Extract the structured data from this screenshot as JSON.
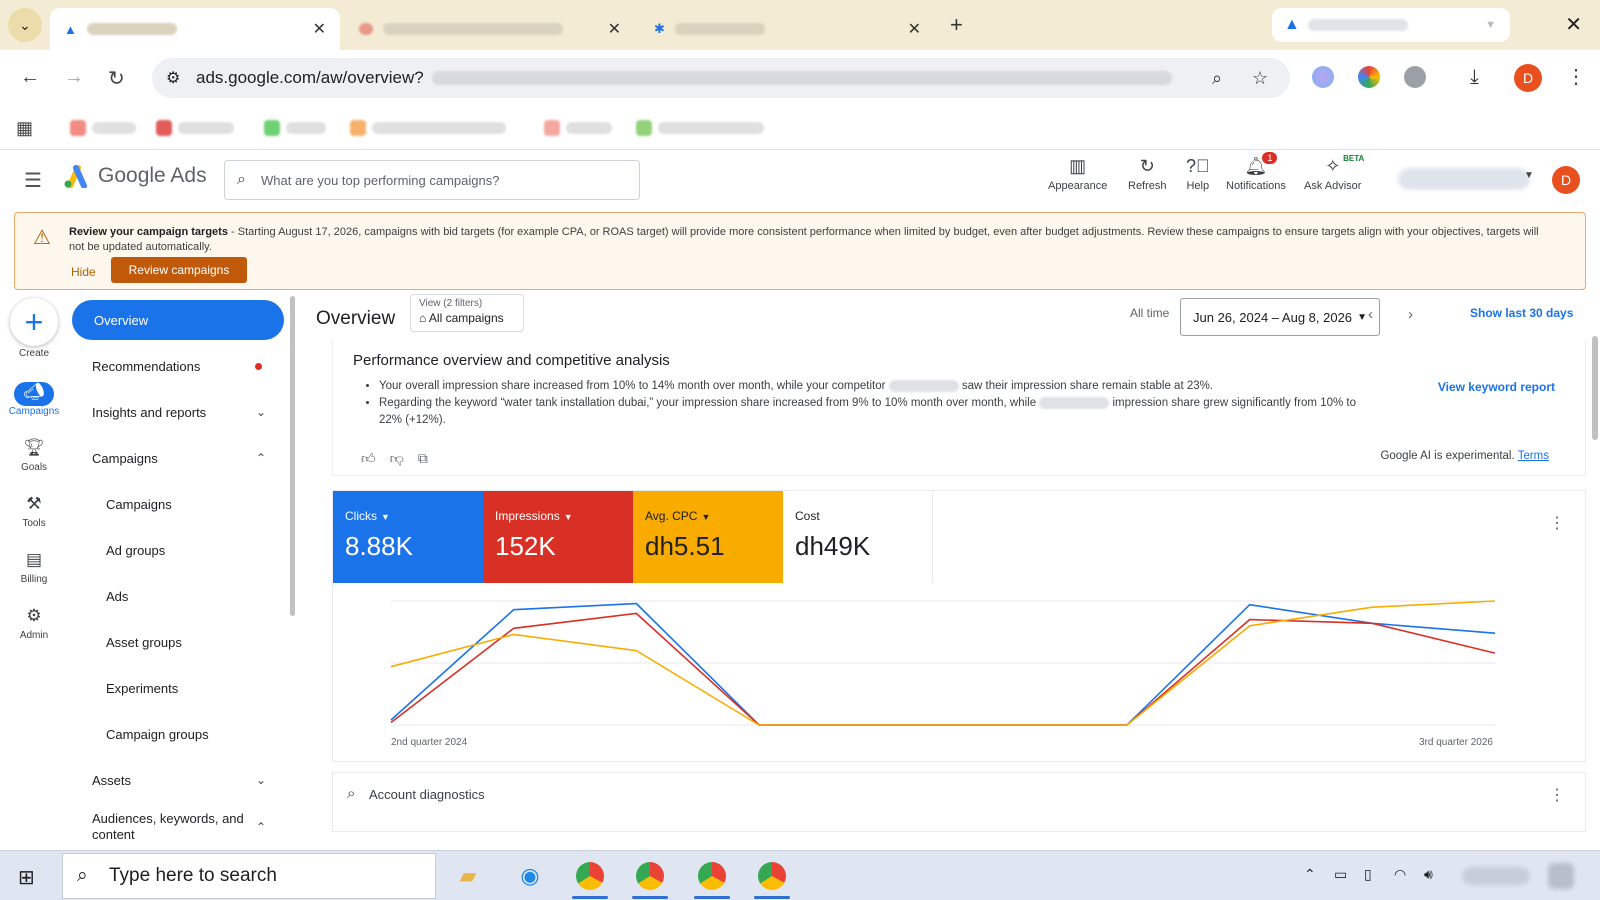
{
  "browser": {
    "url": "ads.google.com/aw/overview?"
  },
  "header": {
    "logo_text": "Google Ads",
    "search_placeholder": "What are you top performing campaigns?",
    "buttons": [
      {
        "label": "Appearance",
        "icon": "appearance-icon"
      },
      {
        "label": "Refresh",
        "icon": "refresh-icon"
      },
      {
        "label": "Help",
        "icon": "help-icon"
      },
      {
        "label": "Notifications",
        "icon": "bell-icon",
        "badge": "1"
      },
      {
        "label": "Ask Advisor",
        "icon": "advisor-icon",
        "tag": "BETA"
      }
    ],
    "avatar": "D"
  },
  "banner": {
    "title": "Review your campaign targets",
    "text": " - Starting August 17, 2026, campaigns with bid targets (for example CPA, or ROAS target) will provide more consistent performance when limited by budget, even after budget adjustments. Review these campaigns to ensure targets align with your objectives, targets will not be updated automatically.",
    "hide_label": "Hide",
    "action_label": "Review campaigns"
  },
  "rail": {
    "create": "Create",
    "items": [
      {
        "label": "Campaigns",
        "icon": "campaigns-icon",
        "active": true
      },
      {
        "label": "Goals",
        "icon": "trophy-icon"
      },
      {
        "label": "Tools",
        "icon": "tools-icon"
      },
      {
        "label": "Billing",
        "icon": "billing-icon"
      },
      {
        "label": "Admin",
        "icon": "gear-icon"
      }
    ]
  },
  "sidenav": {
    "items": [
      {
        "label": "Overview",
        "active": true
      },
      {
        "label": "Recommendations",
        "dot": true
      },
      {
        "label": "Insights and reports",
        "caret": "down"
      },
      {
        "label": "Campaigns",
        "caret": "up"
      },
      {
        "label": "Campaigns",
        "sub": true
      },
      {
        "label": "Ad groups",
        "sub": true
      },
      {
        "label": "Ads",
        "sub": true
      },
      {
        "label": "Asset groups",
        "sub": true
      },
      {
        "label": "Experiments",
        "sub": true
      },
      {
        "label": "Campaign groups",
        "sub": true
      },
      {
        "label": "Assets",
        "caret": "down"
      },
      {
        "label": "Audiences, keywords, and content",
        "caret": "up"
      }
    ]
  },
  "main": {
    "title": "Overview",
    "view_filters": "View (2 filters)",
    "view_value": "All campaigns",
    "all_time": "All time",
    "date_range": "Jun 26, 2024 – Aug 8, 2026",
    "show_last": "Show last 30 days"
  },
  "perf": {
    "title": "Performance overview and competitive analysis",
    "bullet1_a": "Your overall impression share increased from 10% to 14% month over month, while your competitor ",
    "bullet1_b": " saw their impression share remain stable at 23%.",
    "bullet2_a": "Regarding the keyword “water tank installation dubai,” your impression share increased from 9% to 10% month over month, while ",
    "bullet2_b": " impression share grew significantly from 10% to 22% (+12%).",
    "link": "View keyword report",
    "ai_note": "Google AI is experimental.",
    "terms": "Terms"
  },
  "metrics": [
    {
      "label": "Clicks",
      "value": "8.88K",
      "color": "#1a73e8"
    },
    {
      "label": "Impressions",
      "value": "152K",
      "color": "#d93025"
    },
    {
      "label": "Avg. CPC",
      "value": "dh5.51",
      "color": "#f9ab00"
    },
    {
      "label": "Cost",
      "value": "dh49K",
      "color": "#ffffff"
    }
  ],
  "chart_data": {
    "type": "line",
    "x_start_label": "2nd quarter 2024",
    "x_end_label": "3rd quarter 2026",
    "x": [
      0,
      1,
      2,
      3,
      4,
      5,
      6,
      7,
      8,
      9
    ],
    "series": [
      {
        "name": "Clicks",
        "color": "#1a73e8",
        "values": [
          0.04,
          0.93,
          0.98,
          0.0,
          0.0,
          0.0,
          0.0,
          0.97,
          0.82,
          0.74
        ]
      },
      {
        "name": "Impressions",
        "color": "#d93025",
        "values": [
          0.02,
          0.78,
          0.9,
          0.0,
          0.0,
          0.0,
          0.0,
          0.85,
          0.82,
          0.58
        ]
      },
      {
        "name": "Avg. CPC",
        "color": "#f9ab00",
        "values": [
          0.47,
          0.73,
          0.6,
          0.0,
          0.0,
          0.0,
          0.0,
          0.8,
          0.95,
          1.0
        ]
      }
    ],
    "ylim": [
      0,
      1
    ],
    "grid": true
  },
  "diagnostics": {
    "title": "Account diagnostics"
  },
  "taskbar": {
    "search": "Type here to search"
  }
}
